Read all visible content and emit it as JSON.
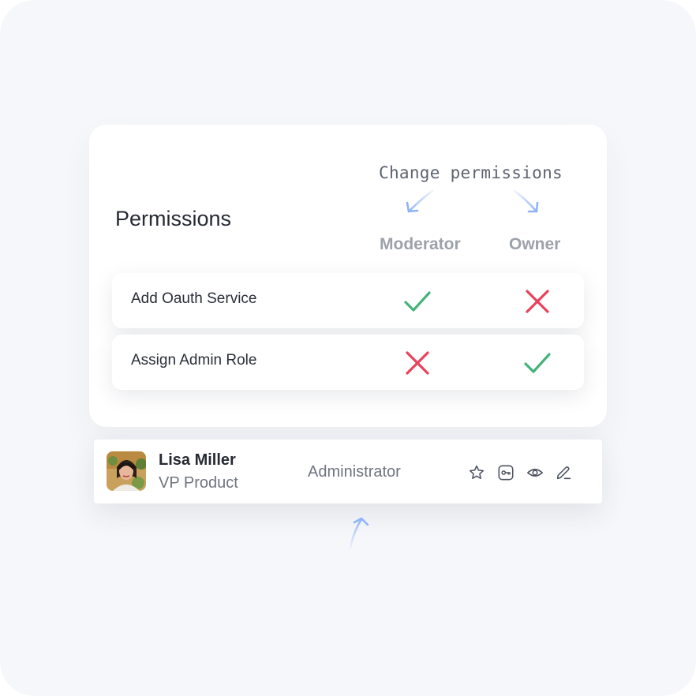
{
  "annotation": {
    "text": "Change permissions"
  },
  "permissions": {
    "title": "Permissions",
    "columns": [
      "Moderator",
      "Owner"
    ],
    "rows": [
      {
        "label": "Add Oauth Service",
        "moderator": "allowed",
        "owner": "denied"
      },
      {
        "label": "Assign Admin Role",
        "moderator": "denied",
        "owner": "allowed"
      }
    ]
  },
  "user": {
    "name": "Lisa Miller",
    "title": "VP Product",
    "role": "Administrator",
    "actions": [
      "star-icon",
      "key-icon",
      "eye-icon",
      "edit-icon"
    ]
  },
  "colors": {
    "check": "#44b37a",
    "cross": "#e9415a",
    "arrow": "#8fb4f7"
  }
}
